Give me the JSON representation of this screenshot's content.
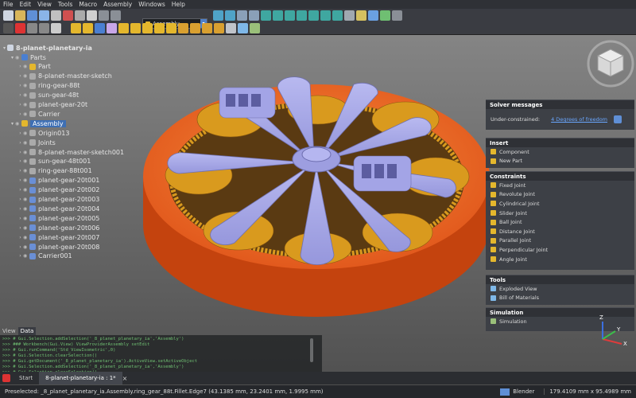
{
  "menu": [
    "File",
    "Edit",
    "View",
    "Tools",
    "Macro",
    "Assembly",
    "Windows",
    "Help"
  ],
  "workbench": "Assembly",
  "tree": {
    "root": "8-planet-planetary-ia",
    "rows": [
      {
        "label": "Parts",
        "icon": "#4a7fd1",
        "depth": 1,
        "arrow": "v"
      },
      {
        "label": "Part",
        "icon": "#e4b72d",
        "depth": 2,
        "arrow": ">"
      },
      {
        "label": "8-planet-master-sketch",
        "icon": "#aaa",
        "depth": 2,
        "arrow": ">"
      },
      {
        "label": "ring-gear-88t",
        "icon": "#aaa",
        "depth": 2,
        "arrow": ">"
      },
      {
        "label": "sun-gear-48t",
        "icon": "#aaa",
        "depth": 2,
        "arrow": ">"
      },
      {
        "label": "planet-gear-20t",
        "icon": "#aaa",
        "depth": 2,
        "arrow": ">"
      },
      {
        "label": "Carrier",
        "icon": "#aaa",
        "depth": 2,
        "arrow": ">"
      },
      {
        "label": "Assembly",
        "icon": "#e4b72d",
        "depth": 1,
        "arrow": "v",
        "selected": true
      },
      {
        "label": "Origin013",
        "icon": "#aaa",
        "depth": 2,
        "arrow": ">"
      },
      {
        "label": "Joints",
        "icon": "#aaa",
        "depth": 2,
        "arrow": ">"
      },
      {
        "label": "8-planet-master-sketch001",
        "icon": "#aaa",
        "depth": 2,
        "arrow": ">"
      },
      {
        "label": "sun-gear-48t001",
        "icon": "#aaa",
        "depth": 2,
        "arrow": ">"
      },
      {
        "label": "ring-gear-88t001",
        "icon": "#aaa",
        "depth": 2,
        "arrow": ">"
      },
      {
        "label": "planet-gear-20t001",
        "icon": "#6a8fd6",
        "depth": 2,
        "arrow": ">"
      },
      {
        "label": "planet-gear-20t002",
        "icon": "#6a8fd6",
        "depth": 2,
        "arrow": ">"
      },
      {
        "label": "planet-gear-20t003",
        "icon": "#6a8fd6",
        "depth": 2,
        "arrow": ">"
      },
      {
        "label": "planet-gear-20t004",
        "icon": "#6a8fd6",
        "depth": 2,
        "arrow": ">"
      },
      {
        "label": "planet-gear-20t005",
        "icon": "#6a8fd6",
        "depth": 2,
        "arrow": ">"
      },
      {
        "label": "planet-gear-20t006",
        "icon": "#6a8fd6",
        "depth": 2,
        "arrow": ">"
      },
      {
        "label": "planet-gear-20t007",
        "icon": "#6a8fd6",
        "depth": 2,
        "arrow": ">"
      },
      {
        "label": "planet-gear-20t008",
        "icon": "#6a8fd6",
        "depth": 2,
        "arrow": ">"
      },
      {
        "label": "Carrier001",
        "icon": "#6a8fd6",
        "depth": 2,
        "arrow": ">"
      }
    ]
  },
  "combo_tabs": [
    "View",
    "Data"
  ],
  "console_lines": [
    ">>> # Gui.Selection.addSelection('_8_planet_planetary_ia','Assembly')",
    ">>> ### Workbench(Gui.View) ViewProviderAssembly setEdit",
    ">>> # Gui.runCommand('Std_ViewIsometric',0)",
    ">>> # Gui.Selection.clearSelection()",
    ">>> # Gui.getDocument('_8_planet_planetary_ia').ActiveView.setActiveObject",
    ">>> # Gui.Selection.addSelection('_8_planet_planetary_ia','Assembly')",
    ">>> # Gui.Selection.clearSelection()"
  ],
  "doc_tabs": {
    "start": "Start",
    "doc": "8-planet-planetary-ia : 1*"
  },
  "status": {
    "preselected": "Preselected: _8_planet_planetary_ia.Assembly.ring_gear_88t.Fillet.Edge7 (43.1385 mm, 23.2401 mm, 1.9995 mm)",
    "nav_style": "Blender",
    "dimensions": "179.4109 mm x 95.4989 mm"
  },
  "panel": {
    "solver": {
      "title": "Solver messages",
      "label": "Under-constrained:",
      "link": "4 Degrees of freedom"
    },
    "insert": {
      "title": "Insert",
      "items": [
        "Component",
        "New Part"
      ]
    },
    "constraints": {
      "title": "Constraints",
      "items": [
        "Fixed Joint",
        "Revolute Joint",
        "Cylindrical Joint",
        "Slider Joint",
        "Ball Joint",
        "Distance Joint",
        "Parallel Joint",
        "Perpendicular Joint",
        "Angle Joint"
      ]
    },
    "tools": {
      "title": "Tools",
      "items": [
        "Exploded View",
        "Bill of Materials"
      ]
    },
    "simulation": {
      "title": "Simulation",
      "items": [
        "Simulation"
      ]
    }
  },
  "axes": {
    "x": "X",
    "y": "Y",
    "z": "Z"
  },
  "colors": {
    "ring": "#e6571a",
    "gear": "#d99a1e",
    "carrier": "#a3a4e6",
    "selection": "#3e6fb4"
  }
}
